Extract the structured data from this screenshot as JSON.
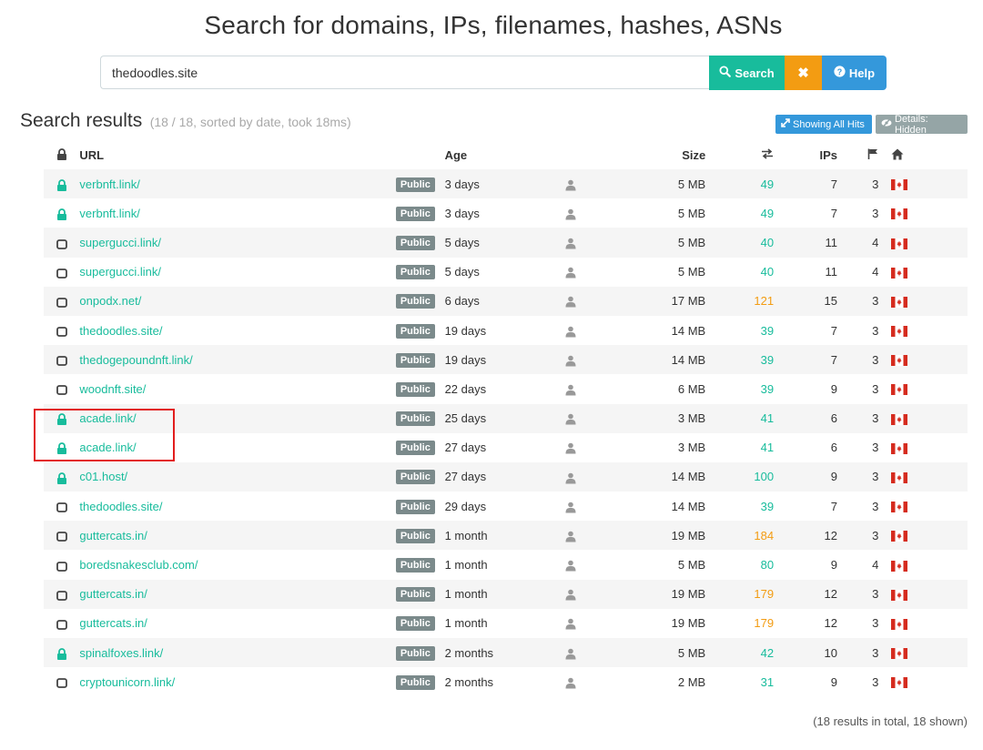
{
  "page": {
    "title": "Search for domains, IPs, filenames, hashes, ASNs"
  },
  "search": {
    "value": "thedoodles.site",
    "search_label": "Search",
    "clear_label": "✖",
    "help_label": "Help"
  },
  "results": {
    "heading": "Search results",
    "meta": "(18 / 18, sorted by date, took 18ms)",
    "showing_label": "Showing All Hits",
    "details_label": "Details: Hidden",
    "footer": "(18 results in total, 18 shown)"
  },
  "columns": {
    "url": "URL",
    "age": "Age",
    "size": "Size",
    "ips": "IPs"
  },
  "colors": {
    "teal": "#18bc9c",
    "orange": "#f39c12",
    "blue": "#3498db",
    "gray": "#95a5a6",
    "highlight": "#e21d1d"
  },
  "rows": [
    {
      "locked": true,
      "url": "verbnft.link/",
      "badge": "Public",
      "age": "3 days",
      "size": "5 MB",
      "redirects": "49",
      "warn": false,
      "ips": "7",
      "countries": "3",
      "flag": "canada-flag-icon"
    },
    {
      "locked": true,
      "url": "verbnft.link/",
      "badge": "Public",
      "age": "3 days",
      "size": "5 MB",
      "redirects": "49",
      "warn": false,
      "ips": "7",
      "countries": "3",
      "flag": "canada-flag-icon"
    },
    {
      "locked": false,
      "url": "supergucci.link/",
      "badge": "Public",
      "age": "5 days",
      "size": "5 MB",
      "redirects": "40",
      "warn": false,
      "ips": "11",
      "countries": "4",
      "flag": "canada-flag-icon"
    },
    {
      "locked": false,
      "url": "supergucci.link/",
      "badge": "Public",
      "age": "5 days",
      "size": "5 MB",
      "redirects": "40",
      "warn": false,
      "ips": "11",
      "countries": "4",
      "flag": "canada-flag-icon"
    },
    {
      "locked": false,
      "url": "onpodx.net/",
      "badge": "Public",
      "age": "6 days",
      "size": "17 MB",
      "redirects": "121",
      "warn": true,
      "ips": "15",
      "countries": "3",
      "flag": "canada-flag-icon"
    },
    {
      "locked": false,
      "url": "thedoodles.site/",
      "badge": "Public",
      "age": "19 days",
      "size": "14 MB",
      "redirects": "39",
      "warn": false,
      "ips": "7",
      "countries": "3",
      "flag": "canada-flag-icon"
    },
    {
      "locked": false,
      "url": "thedogepoundnft.link/",
      "badge": "Public",
      "age": "19 days",
      "size": "14 MB",
      "redirects": "39",
      "warn": false,
      "ips": "7",
      "countries": "3",
      "flag": "canada-flag-icon"
    },
    {
      "locked": false,
      "url": "woodnft.site/",
      "badge": "Public",
      "age": "22 days",
      "size": "6 MB",
      "redirects": "39",
      "warn": false,
      "ips": "9",
      "countries": "3",
      "flag": "canada-flag-icon"
    },
    {
      "locked": true,
      "url": "acade.link/",
      "badge": "Public",
      "age": "25 days",
      "size": "3 MB",
      "redirects": "41",
      "warn": false,
      "ips": "6",
      "countries": "3",
      "flag": "canada-flag-icon"
    },
    {
      "locked": true,
      "url": "acade.link/",
      "badge": "Public",
      "age": "27 days",
      "size": "3 MB",
      "redirects": "41",
      "warn": false,
      "ips": "6",
      "countries": "3",
      "flag": "canada-flag-icon"
    },
    {
      "locked": true,
      "url": "c01.host/",
      "badge": "Public",
      "age": "27 days",
      "size": "14 MB",
      "redirects": "100",
      "warn": false,
      "ips": "9",
      "countries": "3",
      "flag": "canada-flag-icon"
    },
    {
      "locked": false,
      "url": "thedoodles.site/",
      "badge": "Public",
      "age": "29 days",
      "size": "14 MB",
      "redirects": "39",
      "warn": false,
      "ips": "7",
      "countries": "3",
      "flag": "canada-flag-icon"
    },
    {
      "locked": false,
      "url": "guttercats.in/",
      "badge": "Public",
      "age": "1 month",
      "size": "19 MB",
      "redirects": "184",
      "warn": true,
      "ips": "12",
      "countries": "3",
      "flag": "canada-flag-icon"
    },
    {
      "locked": false,
      "url": "boredsnakesclub.com/",
      "badge": "Public",
      "age": "1 month",
      "size": "5 MB",
      "redirects": "80",
      "warn": false,
      "ips": "9",
      "countries": "4",
      "flag": "canada-flag-icon"
    },
    {
      "locked": false,
      "url": "guttercats.in/",
      "badge": "Public",
      "age": "1 month",
      "size": "19 MB",
      "redirects": "179",
      "warn": true,
      "ips": "12",
      "countries": "3",
      "flag": "canada-flag-icon"
    },
    {
      "locked": false,
      "url": "guttercats.in/",
      "badge": "Public",
      "age": "1 month",
      "size": "19 MB",
      "redirects": "179",
      "warn": true,
      "ips": "12",
      "countries": "3",
      "flag": "canada-flag-icon"
    },
    {
      "locked": true,
      "url": "spinalfoxes.link/",
      "badge": "Public",
      "age": "2 months",
      "size": "5 MB",
      "redirects": "42",
      "warn": false,
      "ips": "10",
      "countries": "3",
      "flag": "canada-flag-icon"
    },
    {
      "locked": false,
      "url": "cryptounicorn.link/",
      "badge": "Public",
      "age": "2 months",
      "size": "2 MB",
      "redirects": "31",
      "warn": false,
      "ips": "9",
      "countries": "3",
      "flag": "canada-flag-icon"
    }
  ]
}
